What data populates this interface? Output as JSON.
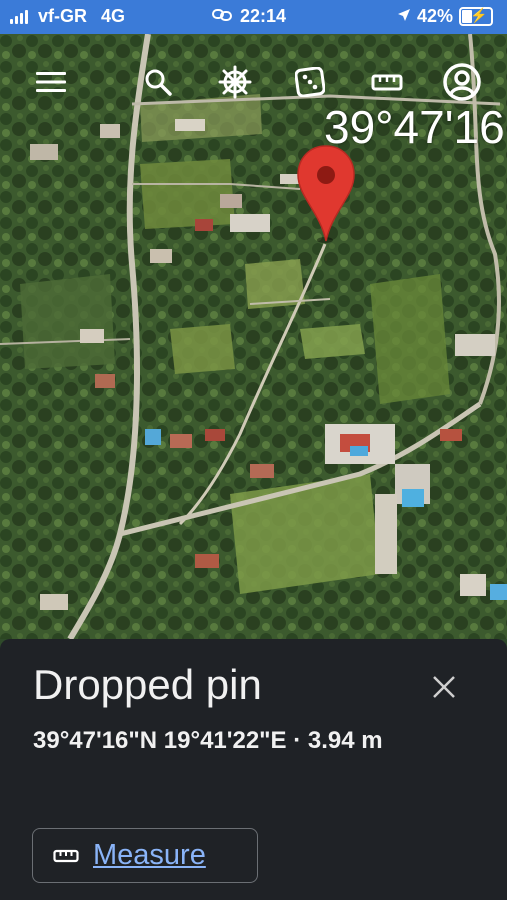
{
  "status_bar": {
    "carrier": "vf-GR",
    "network": "4G",
    "time": "22:14",
    "battery_percent": "42%",
    "battery_level": 0.42,
    "icons": [
      "signal-bars-icon",
      "link-icon",
      "location-arrow-icon",
      "battery-charging-icon"
    ]
  },
  "toolbar": {
    "icons": [
      "menu-icon",
      "search-icon",
      "voyager-wheel-icon",
      "dice-icon",
      "ruler-icon",
      "account-icon"
    ]
  },
  "map": {
    "coordinate_overlay": "39°47'16",
    "pin_color": "#e0382f"
  },
  "sheet": {
    "title": "Dropped pin",
    "coords": "39°47'16\"N 19°41'22\"E · 3.94 m",
    "measure_label": "Measure",
    "close_icon": "close-icon",
    "measure_icon": "ruler-icon"
  },
  "colors": {
    "status_bar_bg": "#3b7bd8",
    "sheet_bg": "#1f2226",
    "link_blue": "#8ab4f8"
  }
}
